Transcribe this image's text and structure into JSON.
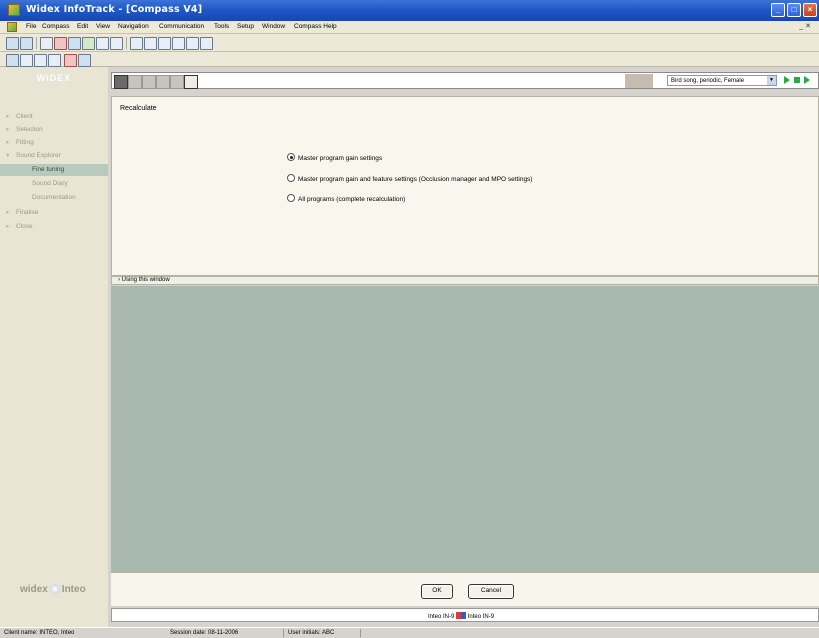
{
  "window": {
    "title": "Widex InfoTrack - [Compass V4]",
    "controls": [
      "_",
      "□",
      "×"
    ]
  },
  "menu": {
    "items": [
      "File",
      "Compass",
      "Edit",
      "View",
      "Navigation",
      "Communication",
      "Tools",
      "Setup",
      "Window",
      "Compass Help"
    ],
    "doc_controls": "_ ✕"
  },
  "sidebar": {
    "logo_top": "WIDEX",
    "items": [
      {
        "label": "Client"
      },
      {
        "label": "Selection"
      },
      {
        "label": "Fitting"
      },
      {
        "label": "Sound Explorer"
      },
      {
        "label": "Fine tuning"
      },
      {
        "label": "Sound Diary"
      },
      {
        "label": "Documentation"
      },
      {
        "label": "Finalise"
      },
      {
        "label": "Close"
      }
    ],
    "brand_left": "widex",
    "brand_right": "Inteo"
  },
  "sound_selector": {
    "value": "Bird song, periodic, Female"
  },
  "recalculate": {
    "title": "Recalculate",
    "options": [
      {
        "label": "Master program gain settings",
        "selected": true
      },
      {
        "label": "Master program gain and feature settings (Occlusion manager and MPO settings)",
        "selected": false
      },
      {
        "label": "All programs (complete recalculation)",
        "selected": false
      }
    ]
  },
  "help_section": {
    "label": "Using this window"
  },
  "buttons": {
    "ok": "OK",
    "cancel": "Cancel"
  },
  "devices": {
    "left": "Inteo IN-9",
    "right": "Inteo IN-9"
  },
  "status": {
    "client": "Client name: INTEO, Inteo",
    "session": "Session date: 08-11-2006",
    "user": "User initials: ABC"
  },
  "colors": {
    "titlebar": "#2058c8",
    "nav_active": "#b9c9bb",
    "content_gray": "#a8b9b0",
    "play_green": "#2aa84a"
  }
}
